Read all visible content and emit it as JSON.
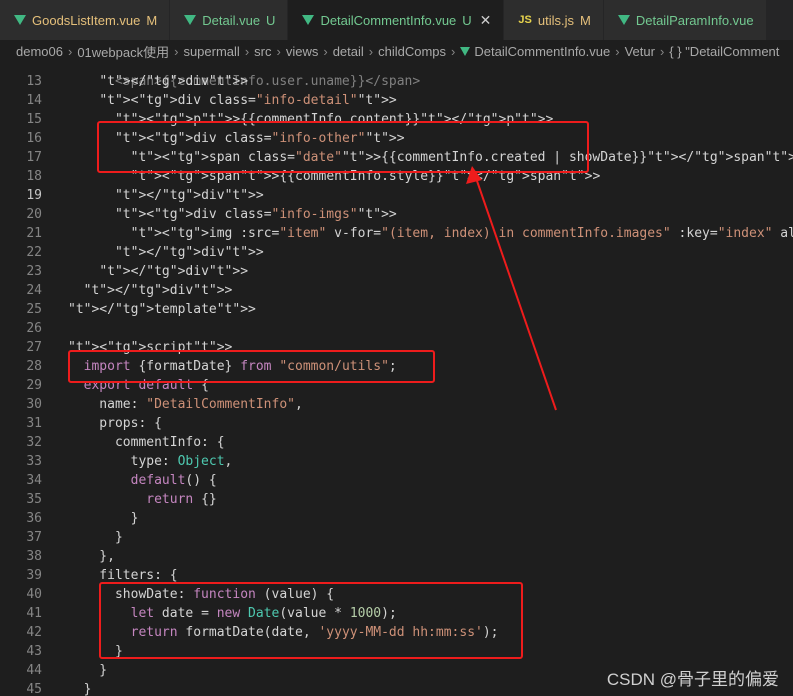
{
  "tabs": [
    {
      "name": "GoodsListItem.vue",
      "status": "M",
      "kind": "vue"
    },
    {
      "name": "Detail.vue",
      "status": "U",
      "kind": "vue"
    },
    {
      "name": "DetailCommentInfo.vue",
      "status": "U",
      "kind": "vue",
      "active": true
    },
    {
      "name": "utils.js",
      "status": "M",
      "kind": "js"
    },
    {
      "name": "DetailParamInfo.vue",
      "status": "",
      "kind": "vue"
    }
  ],
  "breadcrumb": [
    "demo06",
    "01webpack使用",
    "supermall",
    "src",
    "views",
    "detail",
    "childComps",
    "DetailCommentInfo.vue",
    "Vetur",
    "{ } \"DetailComment"
  ],
  "lines": [
    {
      "n": "13",
      "text": "    </div>"
    },
    {
      "n": "14",
      "text": "    <div class=\"info-detail\">"
    },
    {
      "n": "15",
      "text": "      <p>{{commentInfo.content}}</p>"
    },
    {
      "n": "16",
      "text": "      <div class=\"info-other\">"
    },
    {
      "n": "17",
      "text": "        <span class=\"date\">{{commentInfo.created | showDate}}</span>"
    },
    {
      "n": "18",
      "text": "        <span>{{commentInfo.style}}</span>"
    },
    {
      "n": "19",
      "text": "      </div>"
    },
    {
      "n": "20",
      "text": "      <div class=\"info-imgs\">"
    },
    {
      "n": "21",
      "text": "        <img :src=\"item\" v-for=\"(item, index) in commentInfo.images\" :key=\"index\" alt=\"\">"
    },
    {
      "n": "22",
      "text": "      </div>"
    },
    {
      "n": "23",
      "text": "    </div>"
    },
    {
      "n": "24",
      "text": "  </div>"
    },
    {
      "n": "25",
      "text": "</template>"
    },
    {
      "n": "26",
      "text": ""
    },
    {
      "n": "27",
      "text": "<script>"
    },
    {
      "n": "28",
      "text": "  import {formatDate} from \"common/utils\";"
    },
    {
      "n": "29",
      "text": "  export default {"
    },
    {
      "n": "30",
      "text": "    name: \"DetailCommentInfo\","
    },
    {
      "n": "31",
      "text": "    props: {"
    },
    {
      "n": "32",
      "text": "      commentInfo: {"
    },
    {
      "n": "33",
      "text": "        type: Object,"
    },
    {
      "n": "34",
      "text": "        default() {"
    },
    {
      "n": "35",
      "text": "          return {}"
    },
    {
      "n": "36",
      "text": "        }"
    },
    {
      "n": "37",
      "text": "      }"
    },
    {
      "n": "38",
      "text": "    },"
    },
    {
      "n": "39",
      "text": "    filters: {"
    },
    {
      "n": "40",
      "text": "      showDate: function (value) {"
    },
    {
      "n": "41",
      "text": "        let date = new Date(value * 1000);"
    },
    {
      "n": "42",
      "text": "        return formatDate(date, 'yyyy-MM-dd hh:mm:ss');"
    },
    {
      "n": "43",
      "text": "      }"
    },
    {
      "n": "44",
      "text": "    }"
    },
    {
      "n": "45",
      "text": "  }"
    }
  ],
  "partial_top_line": "      <span>{{commentInfo.user.uname}}</span>",
  "watermark": "CSDN @骨子里的偏爱",
  "colors": {
    "annotation": "#ee1c1c",
    "modified": "#e5c07b",
    "untracked": "#73c991"
  }
}
